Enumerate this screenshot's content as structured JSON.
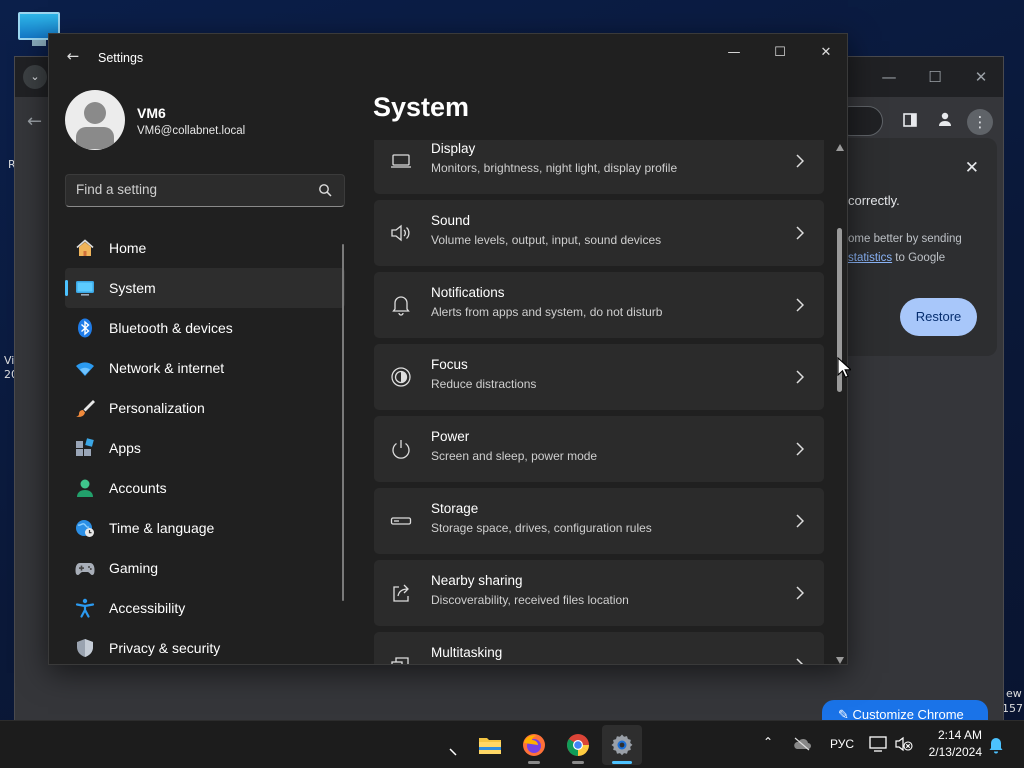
{
  "desktop": {
    "edge_labels_left": [
      "R",
      "Vi",
      "20"
    ],
    "edge_labels_right": [
      "ew",
      "157"
    ]
  },
  "chrome": {
    "crash_bubble": {
      "line1": "correctly.",
      "line2": "ome better by sending",
      "line3_link": "statistics",
      "line3_rest": "to Google",
      "restore_label": "Restore"
    },
    "customize_label": "Customize Chrome"
  },
  "settings": {
    "window_title": "Settings",
    "user": {
      "name": "VM6",
      "email": "VM6@collabnet.local"
    },
    "search_placeholder": "Find a setting",
    "nav": [
      {
        "label": "Home",
        "icon": "home-icon"
      },
      {
        "label": "System",
        "icon": "system-icon",
        "active": true
      },
      {
        "label": "Bluetooth & devices",
        "icon": "bluetooth-icon"
      },
      {
        "label": "Network & internet",
        "icon": "wifi-icon"
      },
      {
        "label": "Personalization",
        "icon": "brush-icon"
      },
      {
        "label": "Apps",
        "icon": "apps-icon"
      },
      {
        "label": "Accounts",
        "icon": "accounts-icon"
      },
      {
        "label": "Time & language",
        "icon": "globe-clock-icon"
      },
      {
        "label": "Gaming",
        "icon": "gamepad-icon"
      },
      {
        "label": "Accessibility",
        "icon": "accessibility-icon"
      },
      {
        "label": "Privacy & security",
        "icon": "shield-icon"
      }
    ],
    "page_title": "System",
    "cards": [
      {
        "title": "Display",
        "subtitle": "Monitors, brightness, night light, display profile",
        "icon": "display-icon"
      },
      {
        "title": "Sound",
        "subtitle": "Volume levels, output, input, sound devices",
        "icon": "speaker-icon"
      },
      {
        "title": "Notifications",
        "subtitle": "Alerts from apps and system, do not disturb",
        "icon": "bell-icon"
      },
      {
        "title": "Focus",
        "subtitle": "Reduce distractions",
        "icon": "focus-icon"
      },
      {
        "title": "Power",
        "subtitle": "Screen and sleep, power mode",
        "icon": "power-icon"
      },
      {
        "title": "Storage",
        "subtitle": "Storage space, drives, configuration rules",
        "icon": "storage-icon"
      },
      {
        "title": "Nearby sharing",
        "subtitle": "Discoverability, received files location",
        "icon": "share-icon"
      },
      {
        "title": "Multitasking",
        "subtitle": "",
        "icon": "multitasking-icon"
      }
    ]
  },
  "taskbar": {
    "apps": [
      "file-explorer-icon",
      "firefox-icon",
      "chrome-icon",
      "settings-icon"
    ],
    "language": "РУС",
    "time": "2:14 AM",
    "date": "2/13/2024"
  },
  "colors": {
    "accent": "#4cc2ff",
    "settings_bg": "#202020",
    "card_bg": "#2b2b2b",
    "chrome_restore": "#a8c7fa"
  }
}
